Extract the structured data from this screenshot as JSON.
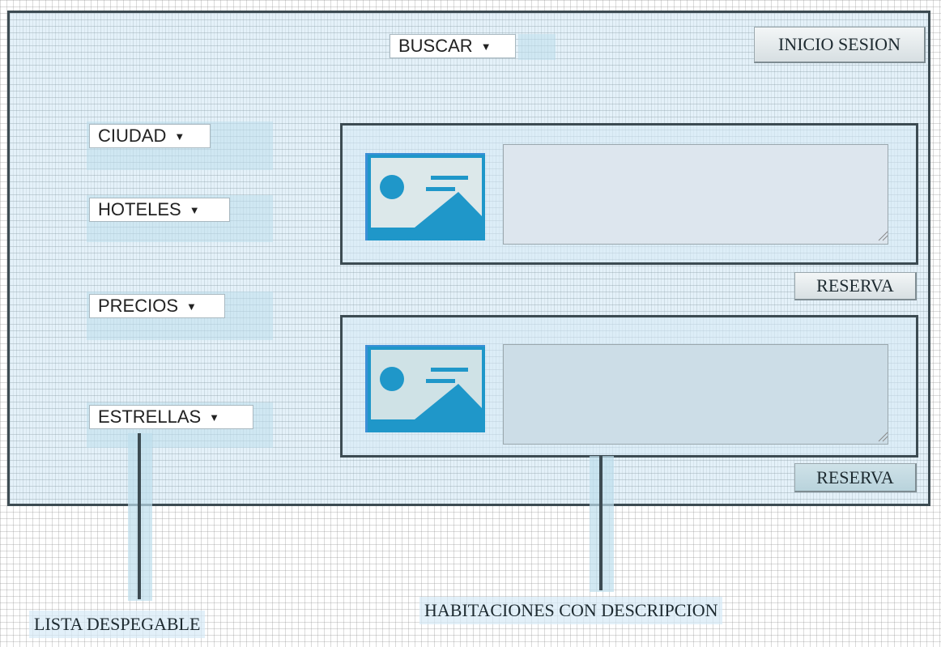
{
  "header": {
    "search_dropdown": "BUSCAR",
    "login_button": "INICIO SESION"
  },
  "filters": {
    "city": "CIUDAD",
    "hotels": "HOTELES",
    "prices": "PRECIOS",
    "stars": "ESTRELLAS"
  },
  "rooms": [
    {
      "reserve_label": "RESERVA",
      "description": ""
    },
    {
      "reserve_label": "RESERVA",
      "description": ""
    }
  ],
  "annotations": {
    "dropdown_note": "LISTA DESPEGABLE",
    "rooms_note": "HABITACIONES CON DESCRIPCION"
  },
  "colors": {
    "accent": "#1f97c9",
    "frame_border": "#3c4b52",
    "panel_fill": "#d6eaf6"
  }
}
